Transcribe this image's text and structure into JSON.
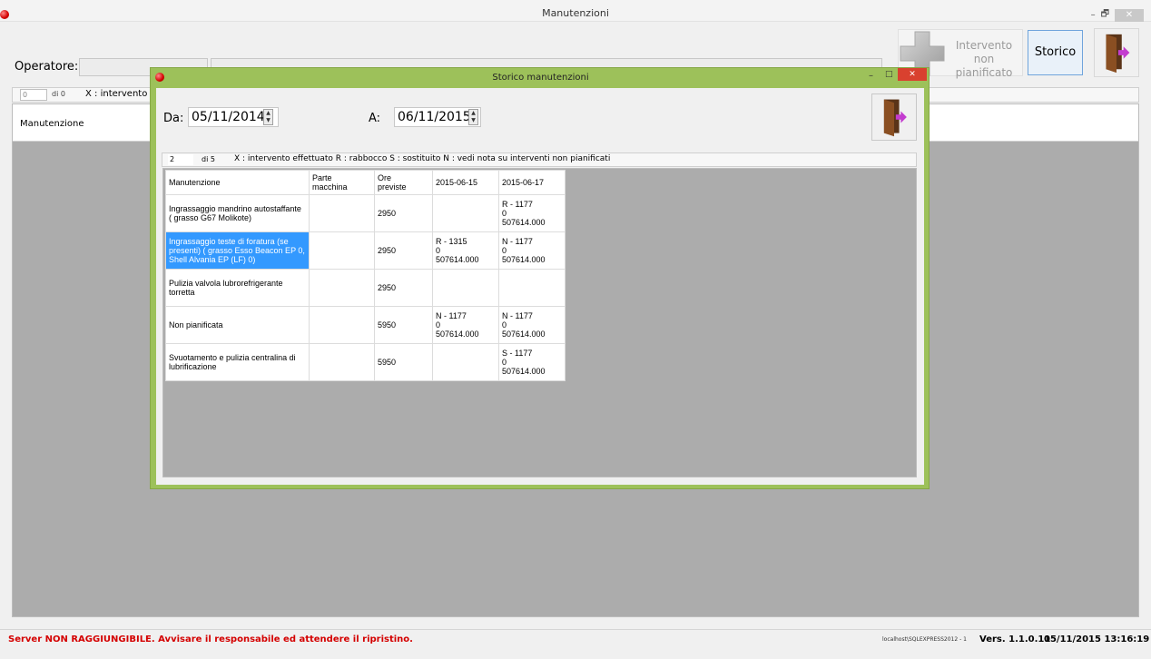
{
  "main_window": {
    "title": "Manutenzioni",
    "controls": {
      "minimize": "–",
      "restore": "🗗",
      "close": "✕"
    },
    "operator_label": "Operatore:",
    "buttons": {
      "intervento_label_line1": "Intervento",
      "intervento_label_line2": "non pianificato",
      "storico_label": "Storico"
    },
    "navigator": {
      "page": "0",
      "of": "di 0",
      "legend": "X : intervento eff"
    },
    "grid_column": "Manutenzione"
  },
  "dialog": {
    "title": "Storico manutenzioni",
    "controls": {
      "minimize": "–",
      "restore": "□",
      "close": "✕"
    },
    "da_label": "Da:",
    "da_value": "05/11/2014",
    "a_label": "A:",
    "a_value": "06/11/2015",
    "navigator": {
      "page": "2",
      "of": "di 5",
      "legend": "X : intervento effettuato    R : rabbocco    S : sostituito    N : vedi nota su interventi non pianificati"
    },
    "table": {
      "headers": [
        "Manutenzione",
        "Parte\nmacchina",
        "Ore\npreviste",
        "2015-06-15",
        "2015-06-17"
      ],
      "rows": [
        {
          "manutenzione": "Ingrassaggio mandrino autostaffante ( grasso G67 Molikote)",
          "parte": "",
          "ore": "2950",
          "d1": "",
          "d2": "R - 1177\n0\n507614.000",
          "selected": false
        },
        {
          "manutenzione": "Ingrassaggio teste di foratura (se presenti)  ( grasso Esso Beacon EP 0, Shell Alvania EP (LF) 0)",
          "parte": "",
          "ore": "2950",
          "d1": "R - 1315\n0\n507614.000",
          "d2": "N - 1177\n0\n507614.000",
          "selected": true
        },
        {
          "manutenzione": "Pulizia valvola lubrorefrigerante torretta",
          "parte": "",
          "ore": "2950",
          "d1": "",
          "d2": "",
          "selected": false
        },
        {
          "manutenzione": "Non pianificata",
          "parte": "",
          "ore": "5950",
          "d1": "N - 1177\n0\n507614.000",
          "d2": "N - 1177\n0\n507614.000",
          "selected": false
        },
        {
          "manutenzione": "Svuotamento e pulizia centralina di lubrificazione",
          "parte": "",
          "ore": "5950",
          "d1": "",
          "d2": "S - 1177\n0\n507614.000",
          "selected": false
        }
      ]
    }
  },
  "status_bar": {
    "error": "Server NON RAGGIUNGIBILE. Avvisare il responsabile ed attendere il ripristino.",
    "server": "localhost\\SQLEXPRESS2012 - 1",
    "version": "Vers. 1.1.0.11",
    "datetime": "05/11/2015 13:16:19"
  },
  "colors": {
    "dialog_frame": "#9dc15a",
    "selection": "#3399ff",
    "error_text": "#d40000",
    "grid_background": "#acacac"
  },
  "icons": [
    "red-ball-icon",
    "plus-icon",
    "exit-door-icon",
    "spin-arrows-icon"
  ]
}
